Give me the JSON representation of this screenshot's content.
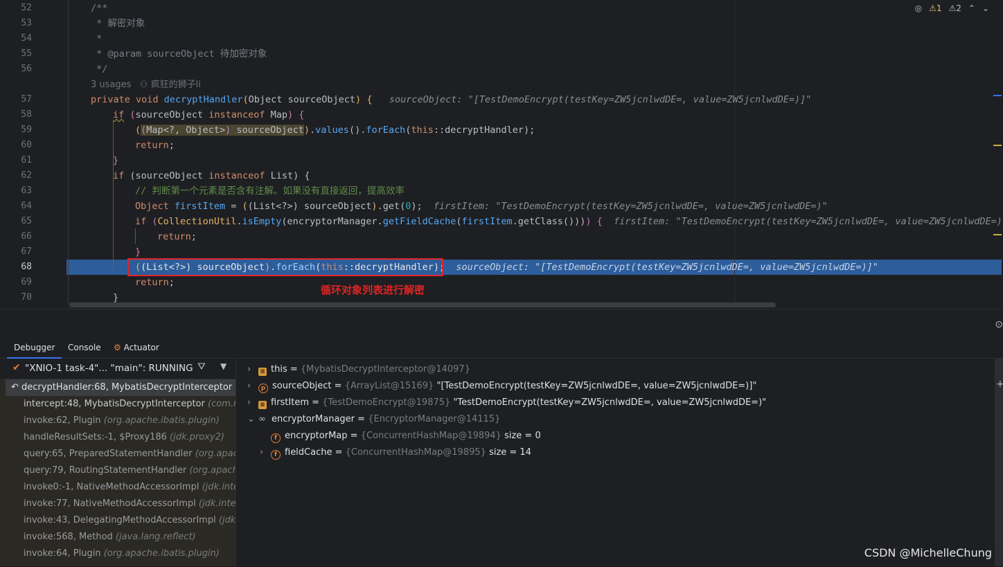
{
  "editor": {
    "line_numbers": [
      "52",
      "53",
      "54",
      "55",
      "56",
      "57",
      "58",
      "59",
      "60",
      "61",
      "62",
      "63",
      "64",
      "65",
      "66",
      "67",
      "68",
      "69",
      "70"
    ],
    "usages": "3 usages",
    "author": "疯狂的狮子li",
    "inspections": {
      "warnings": "1",
      "weak_warnings": "2"
    },
    "annotation": "循环对象列表进行解密",
    "inlay_57": "sourceObject: \"[TestDemoEncrypt(testKey=ZW5jcnlwdDE=, value=ZW5jcnlwdDE=)]\"",
    "inlay_64": "firstItem: \"TestDemoEncrypt(testKey=ZW5jcnlwdDE=, value=ZW5jcnlwdDE=)\"",
    "inlay_65": "firstItem: \"TestDemoEncrypt(testKey=ZW5jcnlwdDE=, value=ZW5jcnlwdDE=)\"",
    "inlay_68": "sourceObject: \"[TestDemoEncrypt(testKey=ZW5jcnlwdDE=, value=ZW5jcnlwdDE=)]\""
  },
  "debugger": {
    "tabs": [
      "Debugger",
      "Console",
      "Actuator"
    ],
    "thread": "\"XNIO-1 task-4\"... \"main\": RUNNING",
    "frames": [
      {
        "method": "decryptHandler:68, MybatisDecryptInterceptor",
        "pkg": "(c"
      },
      {
        "method": "intercept:48, MybatisDecryptInterceptor",
        "pkg": "(com.ruo"
      },
      {
        "method": "invoke:62, Plugin",
        "pkg": "(org.apache.ibatis.plugin)"
      },
      {
        "method": "handleResultSets:-1, $Proxy186",
        "pkg": "(jdk.proxy2)"
      },
      {
        "method": "query:65, PreparedStatementHandler",
        "pkg": "(org.apache"
      },
      {
        "method": "query:79, RoutingStatementHandler",
        "pkg": "(org.apache.i"
      },
      {
        "method": "invoke0:-1, NativeMethodAccessorImpl",
        "pkg": "(jdk.intern"
      },
      {
        "method": "invoke:77, NativeMethodAccessorImpl",
        "pkg": "(jdk.intern"
      },
      {
        "method": "invoke:43, DelegatingMethodAccessorImpl",
        "pkg": "(jdk.in"
      },
      {
        "method": "invoke:568, Method",
        "pkg": "(java.lang.reflect)"
      },
      {
        "method": "invoke:64, Plugin",
        "pkg": "(org.apache.ibatis.plugin)"
      }
    ],
    "variables": [
      {
        "name": "this",
        "id": "{MybatisDecryptInterceptor@14097}",
        "value": ""
      },
      {
        "name": "sourceObject",
        "id": "{ArrayList@15169}",
        "value": "\"[TestDemoEncrypt(testKey=ZW5jcnlwdDE=, value=ZW5jcnlwdDE=)]\""
      },
      {
        "name": "firstItem",
        "id": "{TestDemoEncrypt@19875}",
        "value": "\"TestDemoEncrypt(testKey=ZW5jcnlwdDE=, value=ZW5jcnlwdDE=)\""
      },
      {
        "name": "encryptorManager",
        "id": "{EncryptorManager@14115}",
        "value": ""
      },
      {
        "name": "encryptorMap",
        "id": "{ConcurrentHashMap@19894}",
        "value": "size = 0"
      },
      {
        "name": "fieldCache",
        "id": "{ConcurrentHashMap@19895}",
        "value": "size = 14"
      }
    ]
  },
  "watermark": "CSDN @MichelleChung",
  "colors": {
    "execution_line": "#2d5d9b",
    "highlight_box": "#e5242b",
    "annotation": "#e02424"
  }
}
